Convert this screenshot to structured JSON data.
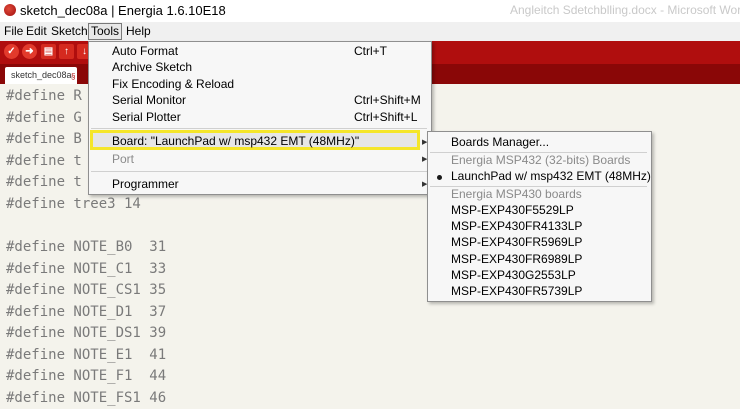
{
  "window": {
    "title": "sketch_dec08a | Energia 1.6.10E18",
    "background_window_title": "Angleitch Sdetchblling.docx - Microsoft Wor"
  },
  "menubar": {
    "file": "File",
    "edit": "Edit",
    "sketch": "Sketch",
    "tools": "Tools",
    "help": "Help"
  },
  "toolbar": {
    "verify": "✓",
    "upload": "➜",
    "new": "▤",
    "open": "↑",
    "save": "↓",
    "accent_color": "#b00e0e"
  },
  "tab": {
    "label": "sketch_dec08a",
    "arrow": "§"
  },
  "code_lines": [
    "#define R",
    "#define G",
    "#define B",
    "#define t",
    "#define t",
    "#define tree3 14",
    "",
    "#define NOTE_B0  31",
    "#define NOTE_C1  33",
    "#define NOTE_CS1 35",
    "#define NOTE_D1  37",
    "#define NOTE_DS1 39",
    "#define NOTE_E1  41",
    "#define NOTE_F1  44",
    "#define NOTE_FS1 46"
  ],
  "tools_menu": {
    "auto_format": "Auto Format",
    "auto_format_shortcut": "Ctrl+T",
    "archive_sketch": "Archive Sketch",
    "fix_encoding": "Fix Encoding & Reload",
    "serial_monitor": "Serial Monitor",
    "serial_monitor_shortcut": "Ctrl+Shift+M",
    "serial_plotter": "Serial Plotter",
    "serial_plotter_shortcut": "Ctrl+Shift+L",
    "board": "Board: \"LaunchPad w/ msp432 EMT (48MHz)\"",
    "port": "Port",
    "programmer": "Programmer",
    "highlight_color": "#f5e62a"
  },
  "board_submenu": {
    "boards_manager": "Boards Manager...",
    "group_msp432": "Energia MSP432 (32-bits) Boards",
    "selected_board": "LaunchPad w/ msp432 EMT (48MHz)",
    "group_msp430": "Energia MSP430 boards",
    "boards": [
      "MSP-EXP430F5529LP",
      "MSP-EXP430FR4133LP",
      "MSP-EXP430FR5969LP",
      "MSP-EXP430FR6989LP",
      "MSP-EXP430G2553LP",
      "MSP-EXP430FR5739LP"
    ]
  }
}
